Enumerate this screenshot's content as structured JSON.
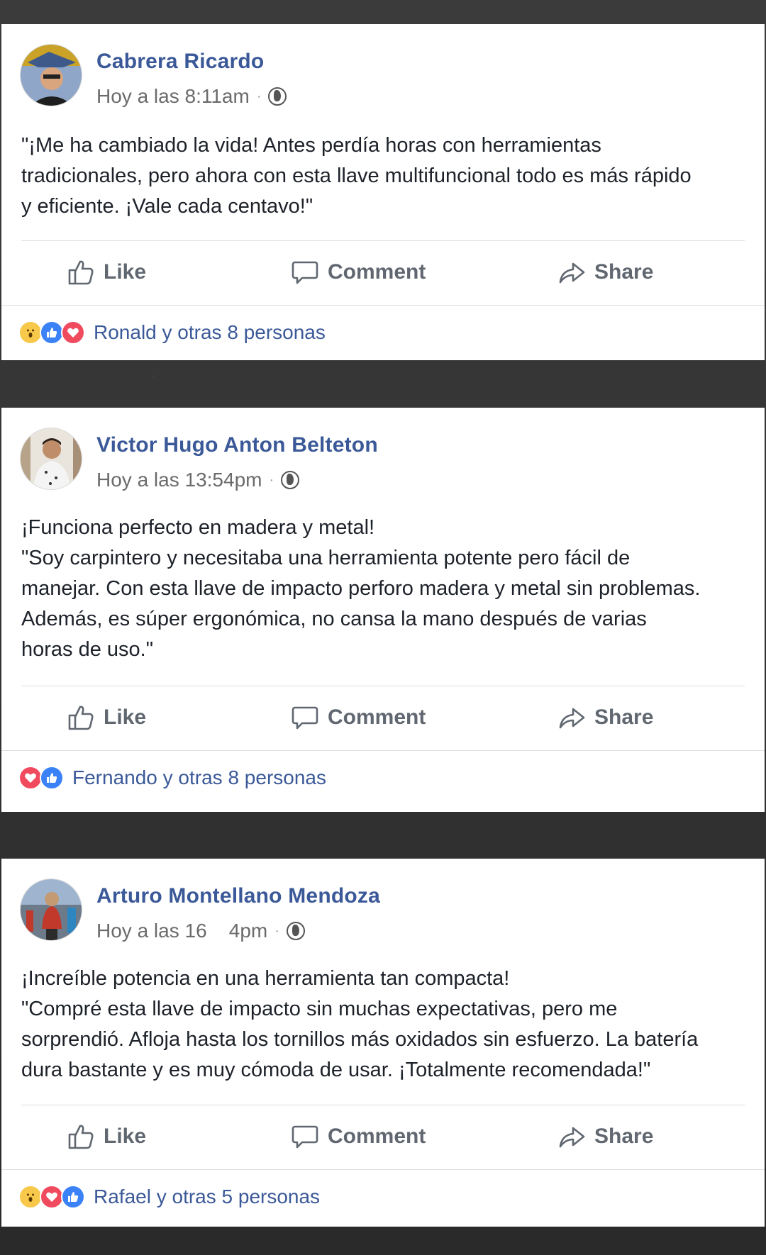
{
  "posts": [
    {
      "author": "Cabrera Ricardo",
      "time": "Hoy a las 8:11am",
      "dot": "·",
      "body": "\"¡Me ha cambiado la vida! Antes perdía horas con herramientas\ntradicionales, pero ahora con esta llave multifuncional todo es más rápido\ny eficiente. ¡Vale cada centavo!\"",
      "actions": {
        "like": "Like",
        "comment": "Comment",
        "share": "Share"
      },
      "reactions": [
        "wow-icon",
        "like-icon",
        "love-icon"
      ],
      "reaction_text": "Ronald y otras 8 personas"
    },
    {
      "author": "Victor Hugo Anton Belteton",
      "time": "Hoy a las 13:54pm",
      "dot": "·",
      "body": "¡Funciona perfecto en madera y metal!\n\"Soy carpintero y necesitaba una herramienta potente pero fácil de\nmanejar. Con esta llave de impacto perforo madera y metal sin problemas.\nAdemás, es súper ergonómica, no cansa la mano después de varias\nhoras de uso.\"",
      "actions": {
        "like": "Like",
        "comment": "Comment",
        "share": "Share"
      },
      "reactions": [
        "love-icon",
        "like-icon"
      ],
      "reaction_text": "Fernando y otras 8 personas"
    },
    {
      "author": "Arturo Montellano Mendoza",
      "time": "Hoy a las 16    4pm",
      "dot": "·",
      "body": "¡Increíble potencia en una herramienta tan compacta!\n\"Compré esta llave de impacto sin muchas expectativas, pero me\nsorprendió. Afloja hasta los tornillos más oxidados sin esfuerzo. La batería\ndura bastante y es muy cómoda de usar. ¡Totalmente recomendada!\"",
      "actions": {
        "like": "Like",
        "comment": "Comment",
        "share": "Share"
      },
      "reactions": [
        "wow-icon",
        "love-icon",
        "like-icon"
      ],
      "reaction_text": "Rafael y otras 5 personas"
    }
  ],
  "colors": {
    "author": "#3b5998",
    "link": "#3b5998",
    "text": "#1d2129",
    "muted": "#606770",
    "like": "#3b82f6",
    "love": "#f04a5f",
    "wow": "#f7c84a"
  }
}
